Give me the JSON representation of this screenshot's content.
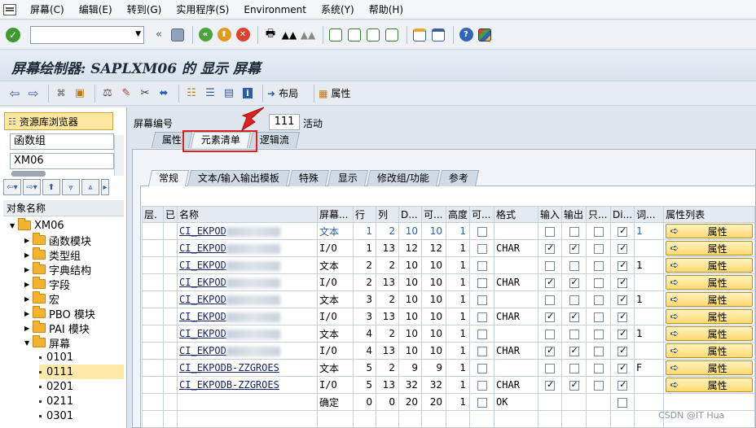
{
  "menu": [
    "屏幕(C)",
    "编辑(E)",
    "转到(G)",
    "实用程序(S)",
    "Environment",
    "系统(Y)",
    "帮助(H)"
  ],
  "title": "屏幕绘制器: SAPLXM06 的 显示 屏幕",
  "appbar": {
    "layout": "布局",
    "attributes": "属性"
  },
  "left": {
    "repo_button": "资源库浏览器",
    "field1": "函数组",
    "field2": "XM06",
    "object_header": "对象名称",
    "tree": {
      "root": "XM06",
      "items": [
        "函数模块",
        "类型组",
        "字典结构",
        "字段",
        "宏",
        "PBO 模块",
        "PAI 模块"
      ],
      "screens_folder": "屏幕",
      "screens": [
        "0101",
        "0111",
        "0201",
        "0211",
        "0301"
      ]
    }
  },
  "screen": {
    "label": "屏幕编号",
    "number": "111",
    "status": "活动"
  },
  "tabs_top": [
    "属性",
    "元素清单",
    "逻辑流"
  ],
  "tabs_sub": [
    "常规",
    "文本/输入输出模板",
    "特殊",
    "显示",
    "修改组/功能",
    "参考"
  ],
  "grid": {
    "headers": [
      "层.",
      "已",
      "名称",
      "屏幕...",
      "行",
      "列",
      "D...",
      "可...",
      "高度",
      "可...",
      "格式",
      "输入",
      "输出",
      "只...",
      "Di...",
      "词...",
      "属性列表"
    ],
    "property_label": "属性",
    "rows": [
      {
        "name": "CI_EKPOD",
        "type": "文本",
        "row": "1",
        "col": "2",
        "d": "10",
        "v": "10",
        "h": "1",
        "fmt": "",
        "cb1": false,
        "inp": false,
        "out": false,
        "ro": false,
        "di": true,
        "word": "1",
        "btn": true
      },
      {
        "name": "CI_EKPOD",
        "type": "I/O",
        "row": "1",
        "col": "13",
        "d": "12",
        "v": "12",
        "h": "1",
        "fmt": "CHAR",
        "cb1": false,
        "inp": true,
        "out": true,
        "ro": false,
        "di": true,
        "word": "",
        "btn": true
      },
      {
        "name": "CI_EKPOD",
        "type": "文本",
        "row": "2",
        "col": "2",
        "d": "10",
        "v": "10",
        "h": "1",
        "fmt": "",
        "cb1": false,
        "inp": false,
        "out": false,
        "ro": false,
        "di": true,
        "word": "1",
        "btn": true
      },
      {
        "name": "CI_EKPOD",
        "type": "I/O",
        "row": "2",
        "col": "13",
        "d": "10",
        "v": "10",
        "h": "1",
        "fmt": "CHAR",
        "cb1": false,
        "inp": true,
        "out": true,
        "ro": false,
        "di": true,
        "word": "",
        "btn": true
      },
      {
        "name": "CI_EKPOD",
        "type": "文本",
        "row": "3",
        "col": "2",
        "d": "10",
        "v": "10",
        "h": "1",
        "fmt": "",
        "cb1": false,
        "inp": false,
        "out": false,
        "ro": false,
        "di": true,
        "word": "1",
        "btn": true
      },
      {
        "name": "CI_EKPOD",
        "type": "I/O",
        "row": "3",
        "col": "13",
        "d": "10",
        "v": "10",
        "h": "1",
        "fmt": "CHAR",
        "cb1": false,
        "inp": true,
        "out": true,
        "ro": false,
        "di": true,
        "word": "",
        "btn": true
      },
      {
        "name": "CI_EKPOD",
        "type": "文本",
        "row": "4",
        "col": "2",
        "d": "10",
        "v": "10",
        "h": "1",
        "fmt": "",
        "cb1": false,
        "inp": false,
        "out": false,
        "ro": false,
        "di": true,
        "word": "1",
        "btn": true
      },
      {
        "name": "CI_EKPOD",
        "type": "I/O",
        "row": "4",
        "col": "13",
        "d": "10",
        "v": "10",
        "h": "1",
        "fmt": "CHAR",
        "cb1": false,
        "inp": true,
        "out": true,
        "ro": false,
        "di": true,
        "word": "",
        "btn": true
      },
      {
        "name": "CI_EKPODB-ZZGROES",
        "type": "文本",
        "row": "5",
        "col": "2",
        "d": "9",
        "v": "9",
        "h": "1",
        "fmt": "",
        "cb1": false,
        "inp": false,
        "out": false,
        "ro": false,
        "di": true,
        "word": "F",
        "btn": true
      },
      {
        "name": "CI_EKPODB-ZZGROES",
        "type": "I/O",
        "row": "5",
        "col": "13",
        "d": "32",
        "v": "32",
        "h": "1",
        "fmt": "CHAR",
        "cb1": false,
        "inp": true,
        "out": true,
        "ro": false,
        "di": true,
        "word": "",
        "btn": true
      },
      {
        "name": "",
        "type": "确定",
        "row": "0",
        "col": "0",
        "d": "20",
        "v": "20",
        "h": "1",
        "fmt": "OK",
        "cb1": false,
        "inp": null,
        "out": null,
        "ro": null,
        "di": false,
        "word": "",
        "btn": false
      }
    ]
  },
  "watermark": "CSDN @IT Hua"
}
